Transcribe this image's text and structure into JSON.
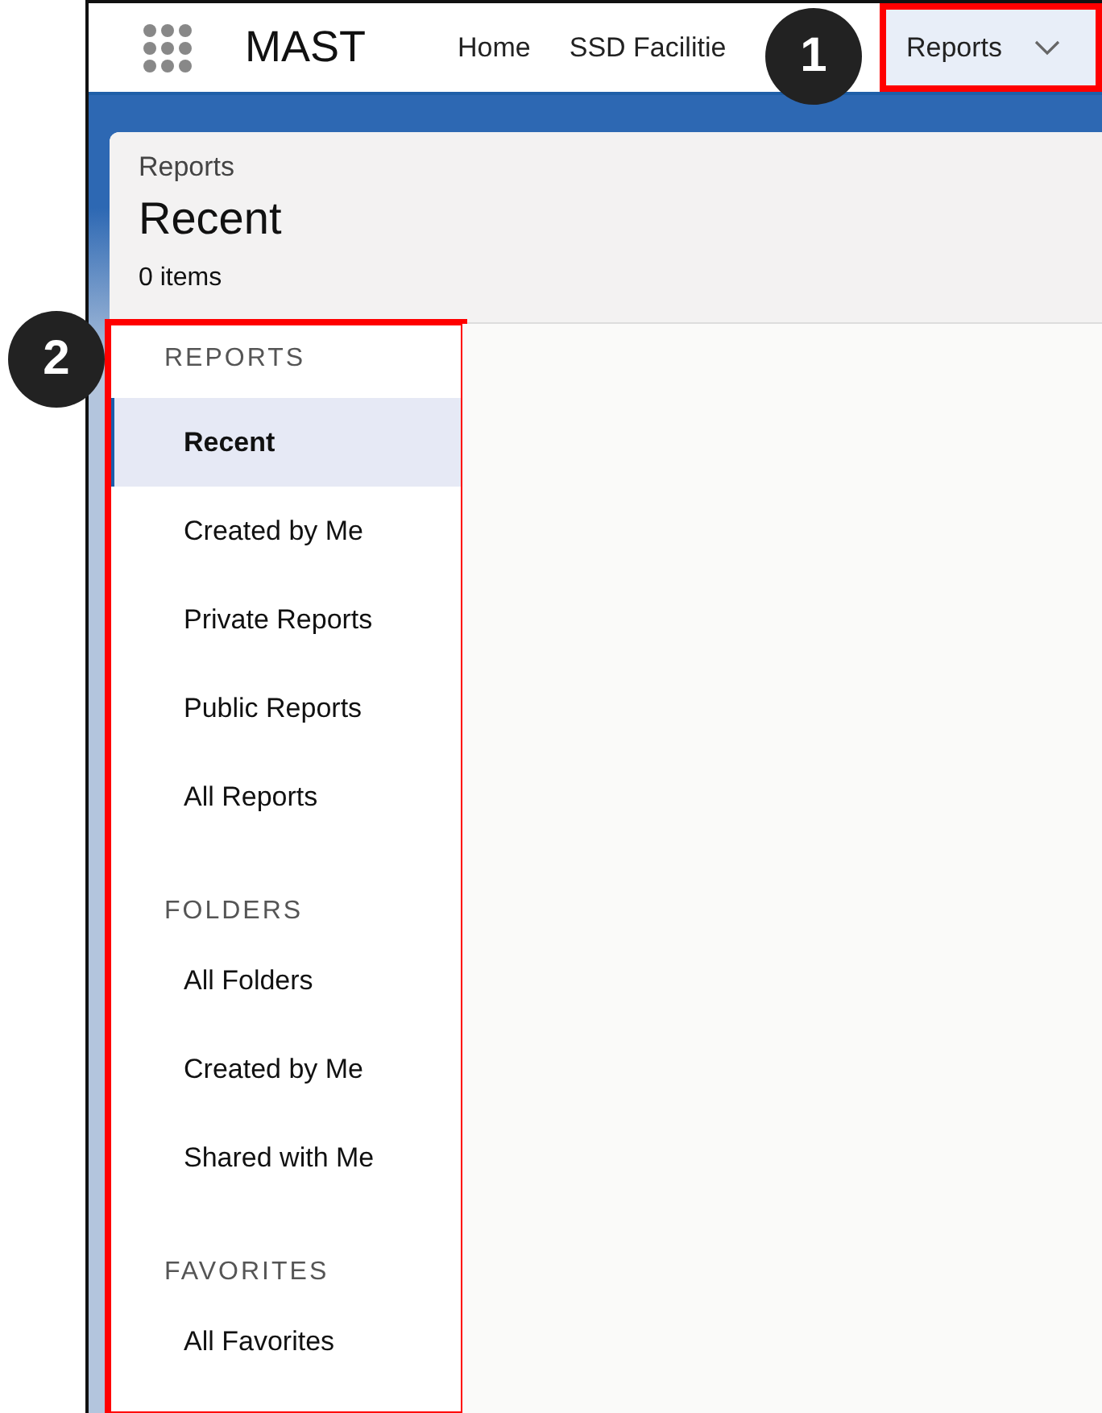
{
  "nav": {
    "app_name": "MAST",
    "tabs": [
      {
        "label": "Home",
        "selected": false,
        "highlighted": false,
        "has_menu": false
      },
      {
        "label": "SSD Facilitie",
        "selected": false,
        "highlighted": false,
        "has_menu": false
      },
      {
        "label": "Reports",
        "selected": true,
        "highlighted": true,
        "has_menu": true
      }
    ]
  },
  "header": {
    "object": "Reports",
    "title": "Recent",
    "count": "0 items"
  },
  "sidebar": {
    "highlighted": true,
    "sections": [
      {
        "heading": "REPORTS",
        "items": [
          {
            "label": "Recent",
            "selected": true
          },
          {
            "label": "Created by Me",
            "selected": false
          },
          {
            "label": "Private Reports",
            "selected": false
          },
          {
            "label": "Public Reports",
            "selected": false
          },
          {
            "label": "All Reports",
            "selected": false
          }
        ]
      },
      {
        "heading": "FOLDERS",
        "items": [
          {
            "label": "All Folders",
            "selected": false
          },
          {
            "label": "Created by Me",
            "selected": false
          },
          {
            "label": "Shared with Me",
            "selected": false
          }
        ]
      },
      {
        "heading": "FAVORITES",
        "items": [
          {
            "label": "All Favorites",
            "selected": false
          }
        ]
      }
    ]
  },
  "callouts": {
    "nav": "1",
    "sidebar": "2"
  }
}
